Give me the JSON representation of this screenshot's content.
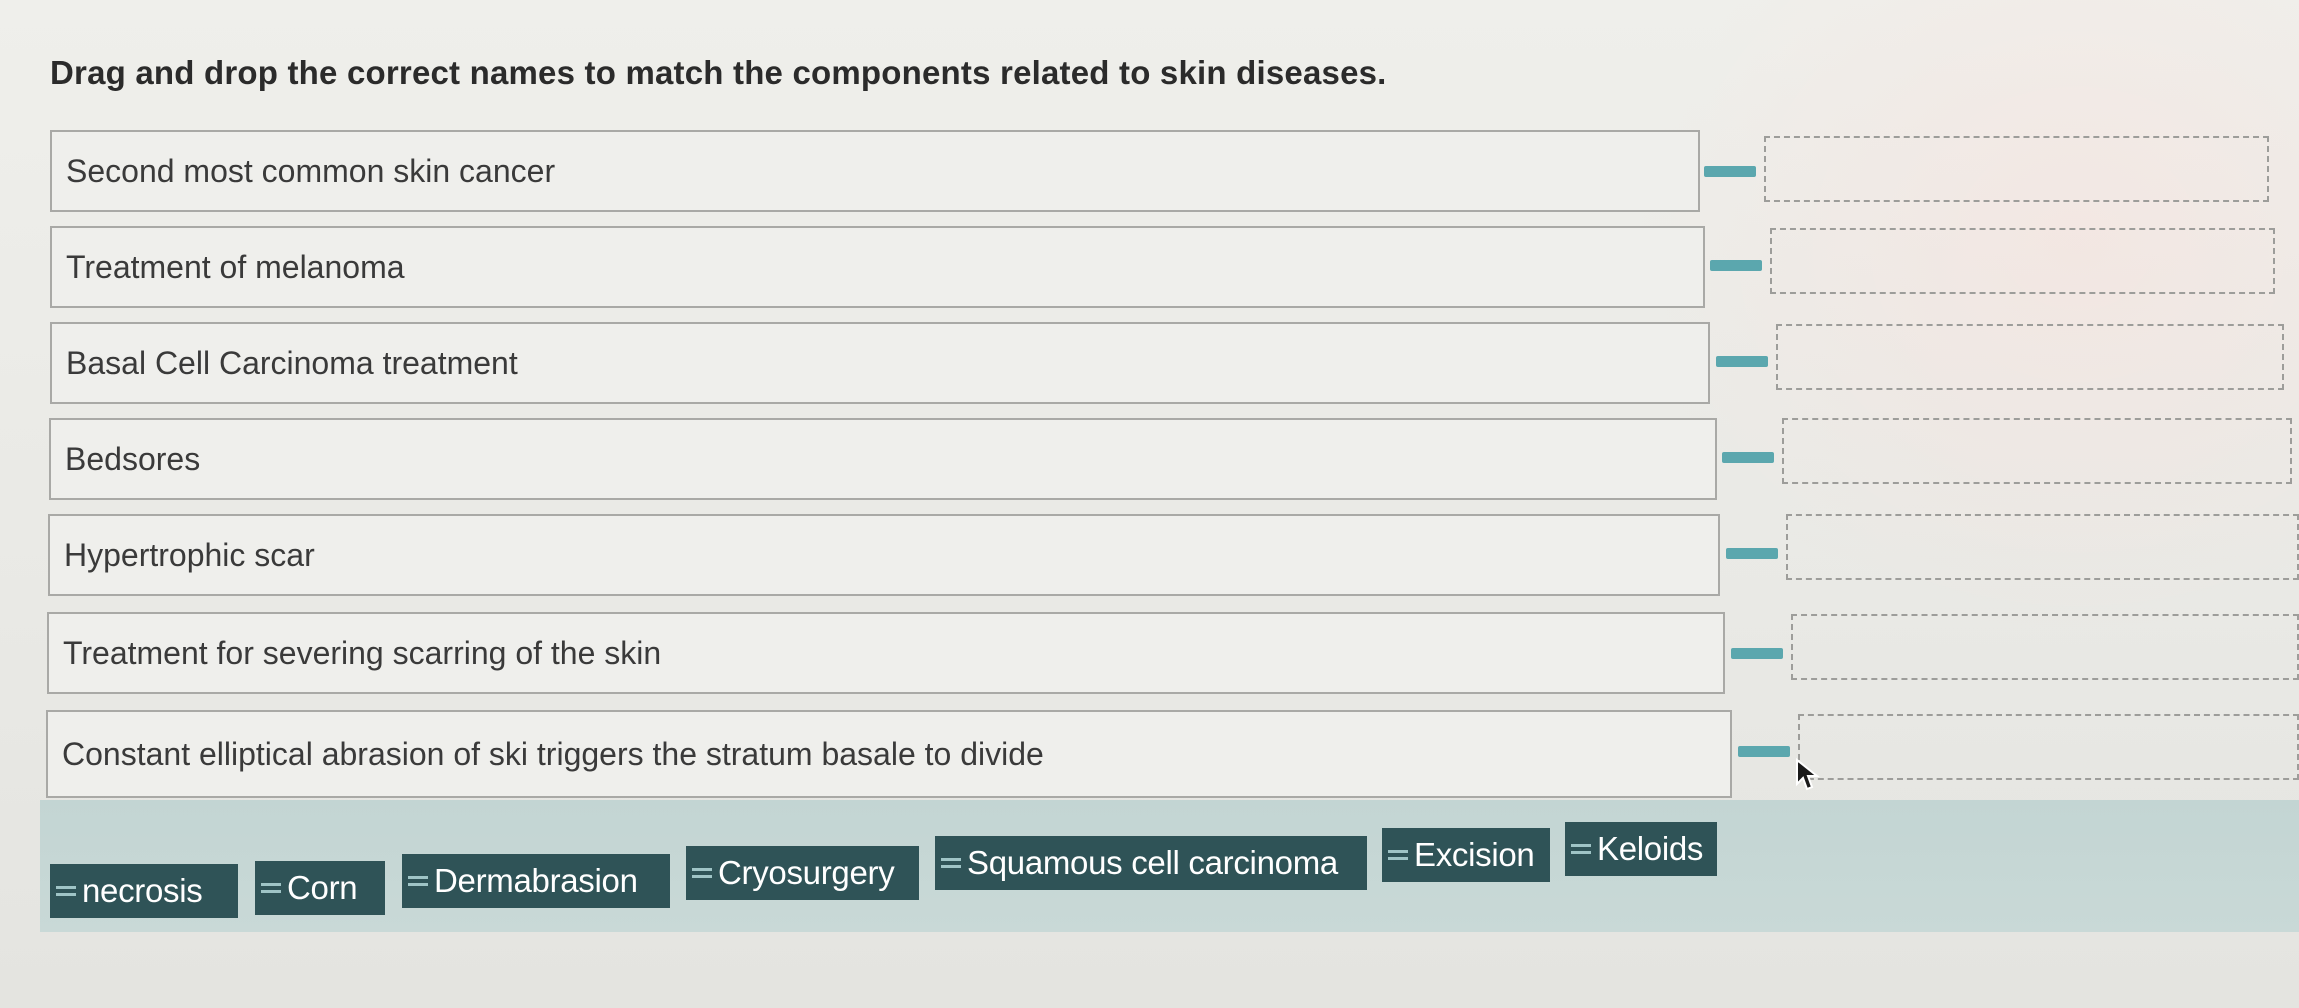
{
  "question": "Drag and drop the correct names to match the components related to skin diseases.",
  "prompts": [
    "Second most common skin cancer",
    "Treatment of melanoma",
    "Basal Cell Carcinoma treatment",
    "Bedsores",
    "Hypertrophic scar",
    "Treatment for severing scarring of the skin",
    "Constant elliptical abrasion of ski triggers the stratum basale to divide"
  ],
  "answers": [
    "necrosis",
    "Corn",
    "Dermabrasion",
    "Cryosurgery",
    "Squamous cell carcinoma",
    "Excision",
    "Keloids"
  ],
  "colors": {
    "chip_bg": "#2f5357",
    "connector": "#5ba7ae",
    "bank_bg": "#c3d5d3"
  }
}
